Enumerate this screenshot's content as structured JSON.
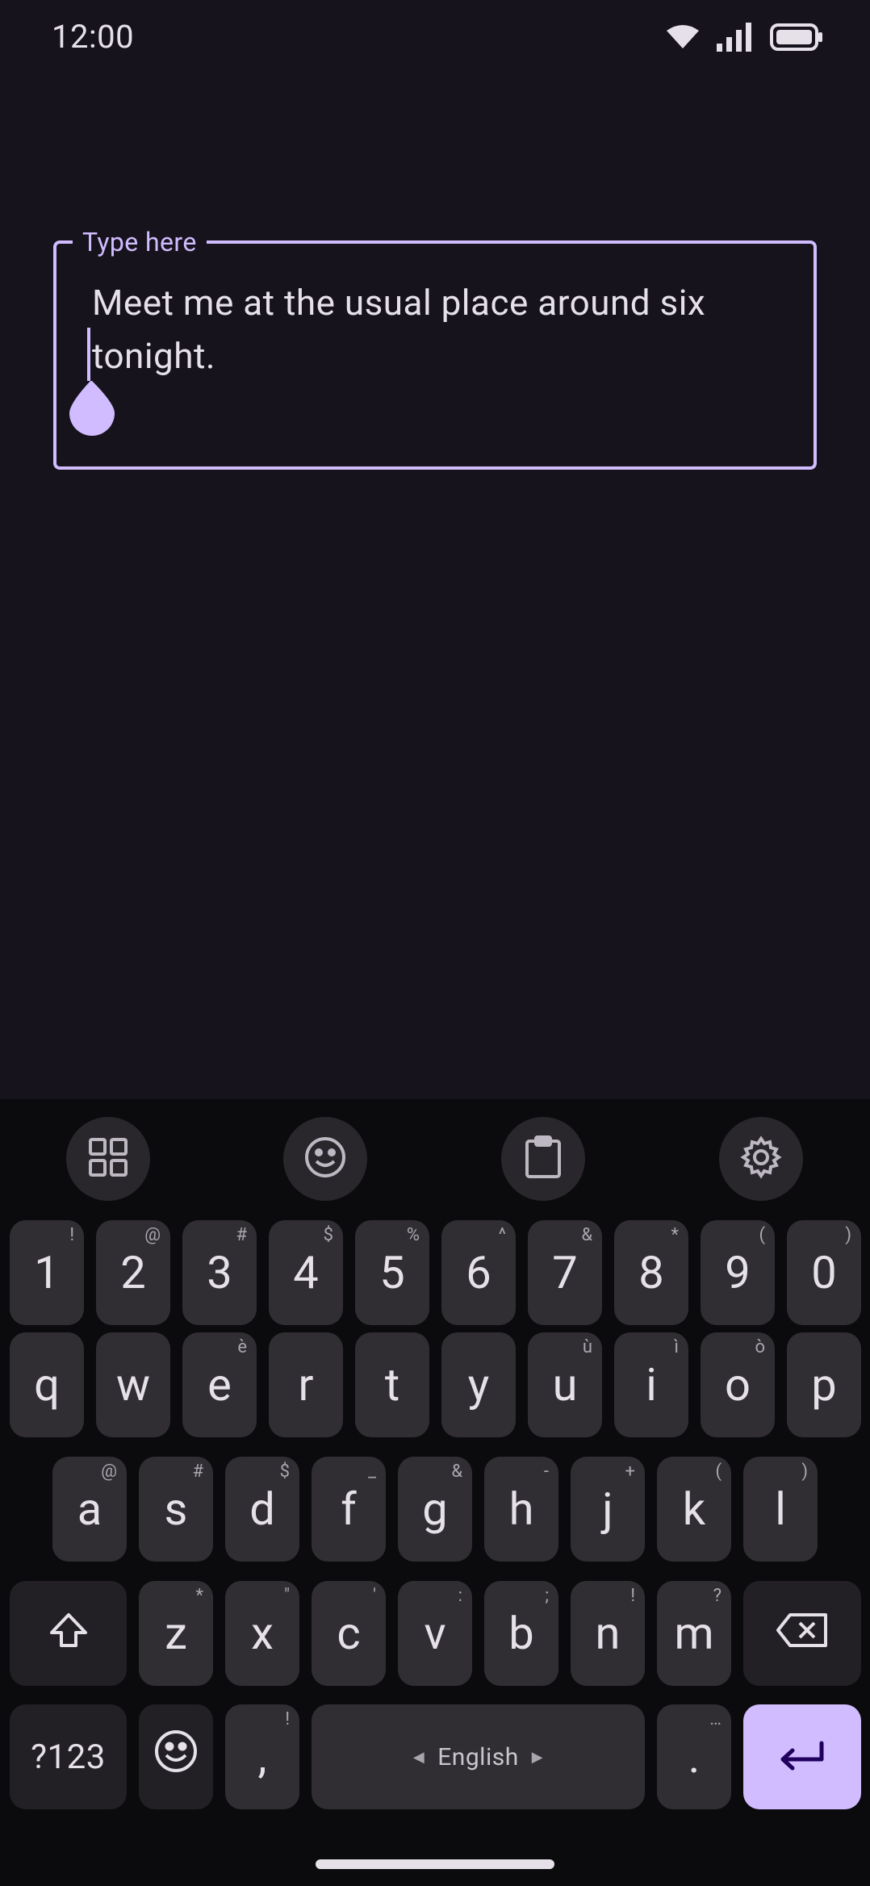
{
  "status_bar": {
    "time": "12:00",
    "icons": [
      "wifi-icon",
      "cellular-signal-icon",
      "battery-icon"
    ]
  },
  "text_field": {
    "label": "Type here",
    "value": "Meet me at the usual place around six tonight."
  },
  "keyboard_toolbar": {
    "buttons": [
      "apps-grid-icon",
      "emoji-icon",
      "clipboard-icon",
      "settings-icon"
    ]
  },
  "keyboard": {
    "row_numbers": [
      {
        "key": "1",
        "hint": "!"
      },
      {
        "key": "2",
        "hint": "@"
      },
      {
        "key": "3",
        "hint": "#"
      },
      {
        "key": "4",
        "hint": "$"
      },
      {
        "key": "5",
        "hint": "%"
      },
      {
        "key": "6",
        "hint": "^"
      },
      {
        "key": "7",
        "hint": "&"
      },
      {
        "key": "8",
        "hint": "*"
      },
      {
        "key": "9",
        "hint": "("
      },
      {
        "key": "0",
        "hint": ")"
      }
    ],
    "row_q": [
      {
        "key": "q",
        "hint": ""
      },
      {
        "key": "w",
        "hint": ""
      },
      {
        "key": "e",
        "hint": "è"
      },
      {
        "key": "r",
        "hint": ""
      },
      {
        "key": "t",
        "hint": ""
      },
      {
        "key": "y",
        "hint": ""
      },
      {
        "key": "u",
        "hint": "ù"
      },
      {
        "key": "i",
        "hint": "ì"
      },
      {
        "key": "o",
        "hint": "ò"
      },
      {
        "key": "p",
        "hint": ""
      }
    ],
    "row_a": [
      {
        "key": "a",
        "hint": "@"
      },
      {
        "key": "s",
        "hint": "#"
      },
      {
        "key": "d",
        "hint": "$"
      },
      {
        "key": "f",
        "hint": "_"
      },
      {
        "key": "g",
        "hint": "&"
      },
      {
        "key": "h",
        "hint": "-"
      },
      {
        "key": "j",
        "hint": "+"
      },
      {
        "key": "k",
        "hint": "("
      },
      {
        "key": "l",
        "hint": ")"
      }
    ],
    "row_z": [
      {
        "key": "z",
        "hint": "*"
      },
      {
        "key": "x",
        "hint": "\""
      },
      {
        "key": "c",
        "hint": "'"
      },
      {
        "key": "v",
        "hint": ":"
      },
      {
        "key": "b",
        "hint": ";"
      },
      {
        "key": "n",
        "hint": "!"
      },
      {
        "key": "m",
        "hint": "?"
      }
    ],
    "symbols_label": "?123",
    "comma": {
      "key": ",",
      "hint": "!"
    },
    "space_label": "English",
    "period": {
      "key": ".",
      "hint": "…"
    }
  },
  "colors": {
    "accent": "#d0bcff",
    "background": "#16131c",
    "keyboard_bg": "#0b0a0d",
    "key_bg": "#302e33"
  }
}
